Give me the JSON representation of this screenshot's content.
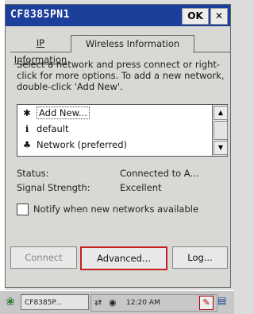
{
  "window": {
    "title": "CF8385PN1",
    "ok_label": "OK",
    "close_label": "✕"
  },
  "tabs": [
    {
      "label": "IP Information",
      "active": false
    },
    {
      "label": "Wireless Information",
      "active": true
    }
  ],
  "intro_text": "Select a network and press connect or right-click for more options.  To add a new network, double-click 'Add New'.",
  "networks": [
    {
      "icon": "star-add-icon",
      "glyph": "✱",
      "label": "Add New..."
    },
    {
      "icon": "info-icon",
      "glyph": "ℹ",
      "label": "default"
    },
    {
      "icon": "network-icon",
      "glyph": "♣",
      "label": "Network (preferred)"
    }
  ],
  "scrollbar": {
    "up": "▲",
    "down": "▼"
  },
  "status": {
    "status_label": "Status:",
    "status_value": "Connected to A...",
    "signal_label": "Signal Strength:",
    "signal_value": "Excellent"
  },
  "notify": {
    "label": "Notify when new networks available",
    "checked": false
  },
  "buttons": {
    "connect": "Connect",
    "advanced": "Advanced...",
    "log": "Log..."
  },
  "taskbar": {
    "task_label": "CF8385P...",
    "time": "12:20 AM",
    "pen_glyph": "✎"
  },
  "colors": {
    "titlebar": "#1c3f9c",
    "highlight_border": "#c42222"
  }
}
